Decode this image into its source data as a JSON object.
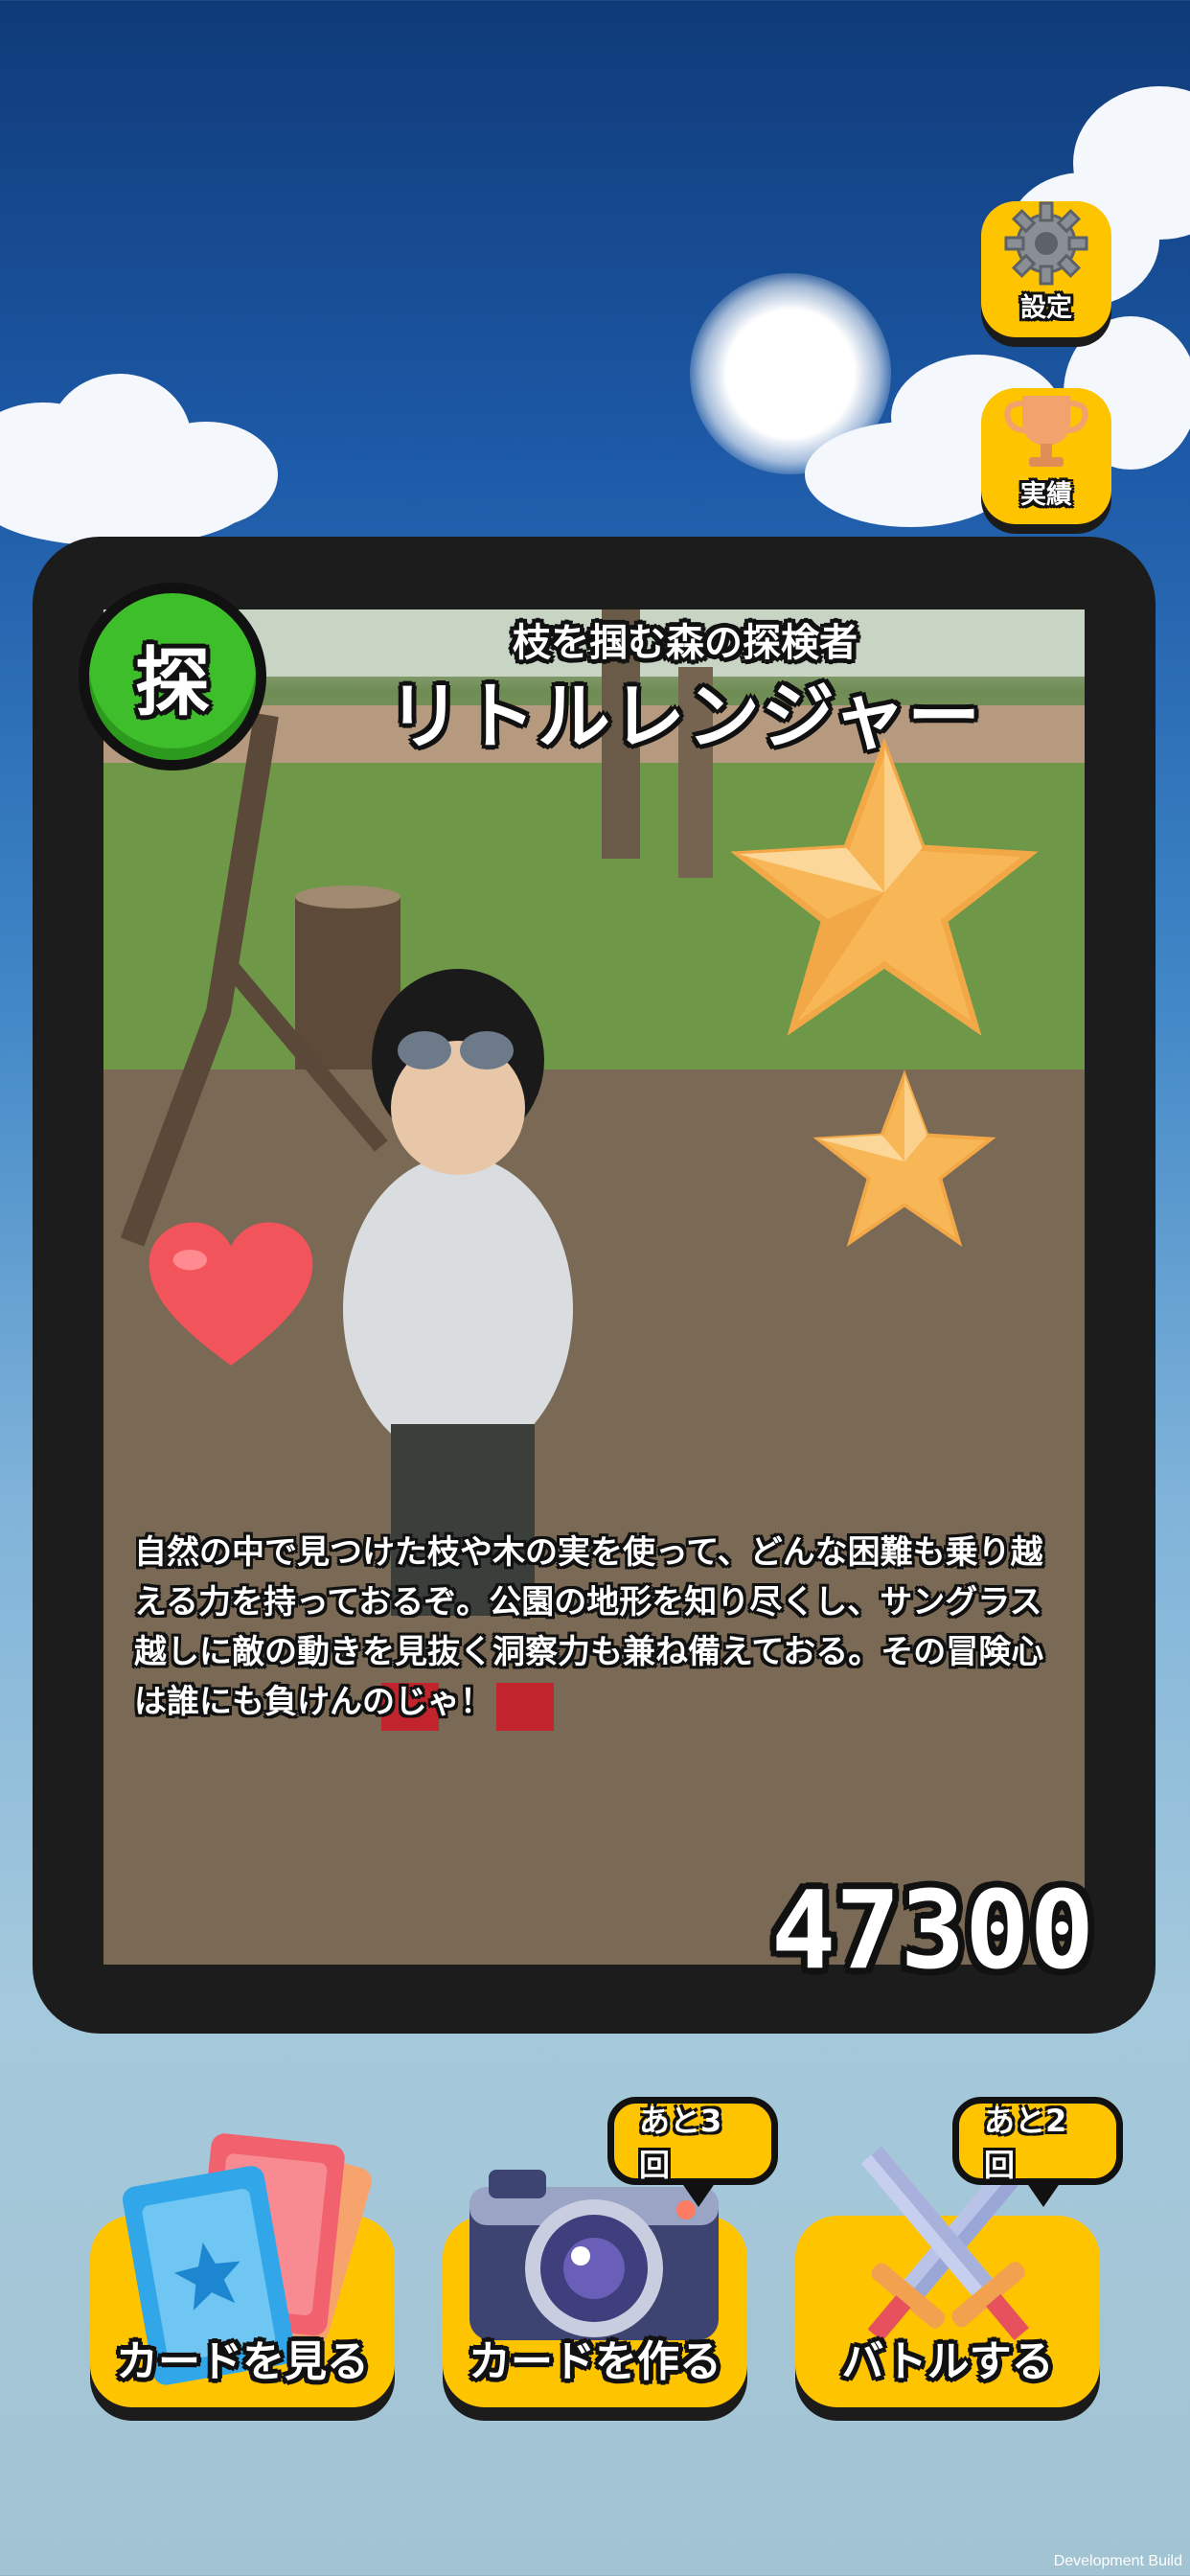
{
  "side_buttons": {
    "settings_label": "設定",
    "achievements_label": "実績"
  },
  "card": {
    "type_badge": "探",
    "subtitle": "枝を掴む森の探検者",
    "title": "リトルレンジャー",
    "description": "自然の中で見つけた枝や木の実を使って、どんな困難も乗り越える力を持っておるぞ。公園の地形を知り尽くし、サングラス越しに敵の動きを見抜く洞察力も兼ね備えておる。その冒険心は誰にも負けんのじゃ！",
    "score": "47300",
    "stars": 2,
    "hearts": 1
  },
  "bottom_buttons": {
    "view_cards_label": "カードを見る",
    "make_card_label": "カードを作る",
    "make_card_remaining": "あと3回",
    "battle_label": "バトルする",
    "battle_remaining": "あと2回"
  },
  "footer": {
    "build_label": "Development Build"
  },
  "colors": {
    "button_yellow": "#ffc400",
    "badge_green": "#3fbe2c",
    "frame_dark": "#1c1c1c"
  }
}
